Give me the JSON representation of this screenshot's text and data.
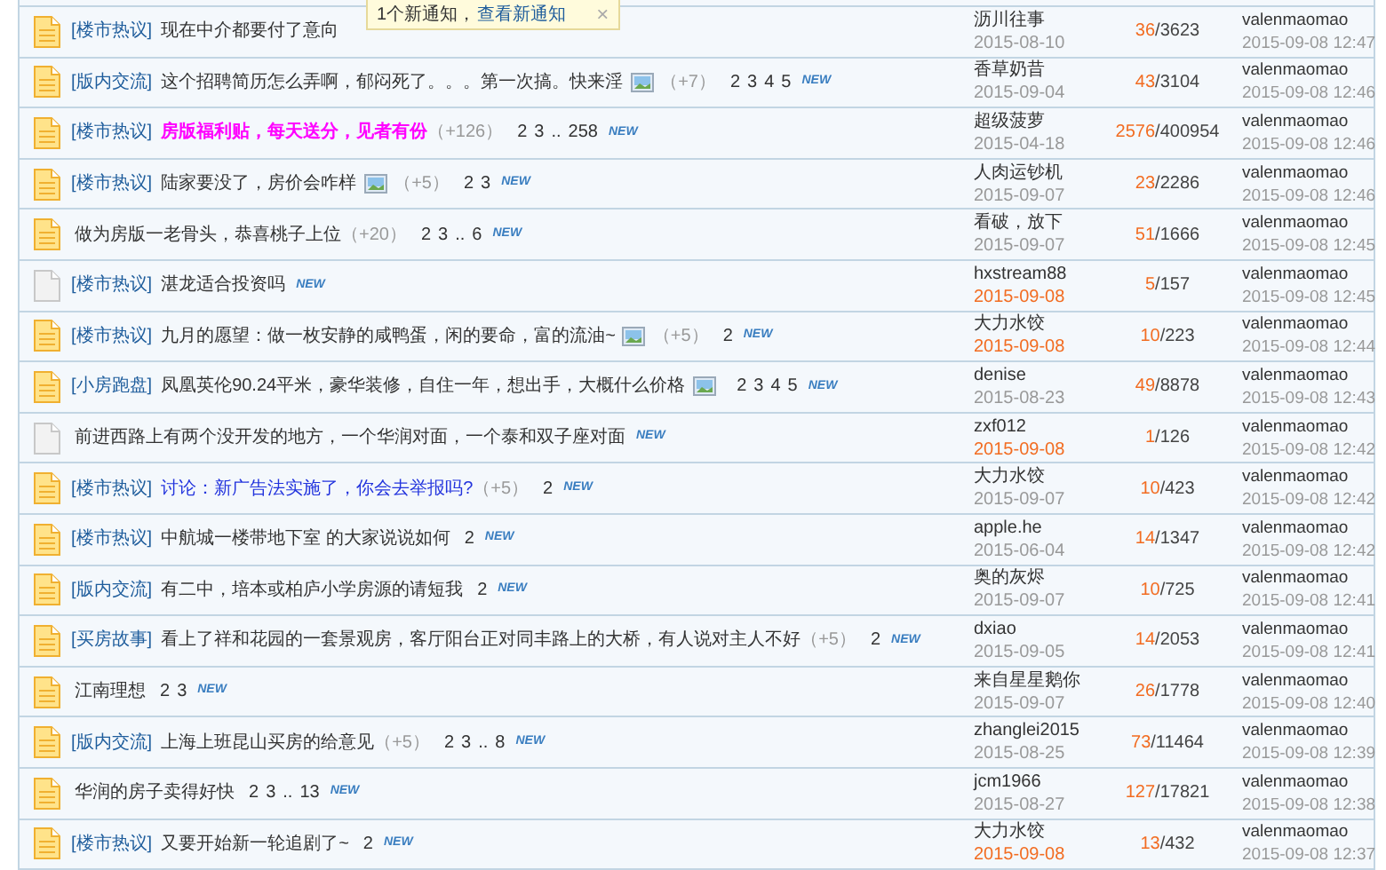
{
  "notification": {
    "text": "1个新通知，",
    "link": "查看新通知",
    "close": "×"
  },
  "threads": [
    {
      "kind": "hot",
      "category": "[楼市热议]",
      "title": "现在中介都要付了意向",
      "author": "沥川往事",
      "date": "2015-08-10",
      "date_recent": false,
      "counts": "36/3623",
      "last_poster": "valenmaomao",
      "last_time": "2015-09-08 12:47"
    },
    {
      "kind": "hot",
      "category": "[版内交流]",
      "title": "这个招聘简历怎么弄啊，郁闷死了。。。第一次搞。快来淫",
      "has_image": true,
      "bonus": "（+7）",
      "pages": [
        "2",
        "3",
        "4",
        "5"
      ],
      "badge": "NEW",
      "author": "香草奶昔",
      "date": "2015-09-04",
      "date_recent": false,
      "counts": "43/3104",
      "last_poster": "valenmaomao",
      "last_time": "2015-09-08 12:46"
    },
    {
      "kind": "hot",
      "category": "[楼市热议]",
      "title": "房版福利贴，每天送分，见者有份",
      "color": "#ff00ff",
      "title_bold": true,
      "bonus": "（+126）",
      "pages": [
        "2",
        "3",
        "..",
        "258"
      ],
      "badge": "NEW",
      "author": "超级菠萝",
      "date": "2015-04-18",
      "date_recent": false,
      "counts": "2576/400954",
      "last_poster": "valenmaomao",
      "last_time": "2015-09-08 12:46"
    },
    {
      "kind": "hot",
      "category": "[楼市热议]",
      "title": "陆家要没了，房价会咋样",
      "has_image": true,
      "bonus": "（+5）",
      "pages": [
        "2",
        "3"
      ],
      "badge": "NEW",
      "author": "人肉运钞机",
      "date": "2015-09-07",
      "date_recent": false,
      "counts": "23/2286",
      "last_poster": "valenmaomao",
      "last_time": "2015-09-08 12:46"
    },
    {
      "kind": "hot",
      "title": "做为房版一老骨头，恭喜桃子上位",
      "bonus": "（+20）",
      "pages": [
        "2",
        "3",
        "..",
        "6"
      ],
      "badge": "NEW",
      "author": "看破，放下",
      "date": "2015-09-07",
      "date_recent": false,
      "counts": "51/1666",
      "last_poster": "valenmaomao",
      "last_time": "2015-09-08 12:45"
    },
    {
      "kind": "normal",
      "category": "[楼市热议]",
      "title": "湛龙适合投资吗",
      "badge": "NEW",
      "author": "hxstream88",
      "date": "2015-09-08",
      "date_recent": true,
      "counts": "5/157",
      "last_poster": "valenmaomao",
      "last_time": "2015-09-08 12:45"
    },
    {
      "kind": "hot",
      "category": "[楼市热议]",
      "title": "九月的愿望：做一枚安静的咸鸭蛋，闲的要命，富的流油~",
      "has_image": true,
      "bonus": "（+5）",
      "pages": [
        "2"
      ],
      "badge": "NEW",
      "author": "大力水饺",
      "date": "2015-09-08",
      "date_recent": true,
      "counts": "10/223",
      "last_poster": "valenmaomao",
      "last_time": "2015-09-08 12:44"
    },
    {
      "kind": "hot",
      "category": "[小房跑盘]",
      "title": "凤凰英伦90.24平米，豪华装修，自住一年，想出手，大概什么价格",
      "has_image": true,
      "pages": [
        "2",
        "3",
        "4",
        "5"
      ],
      "badge": "NEW",
      "author": "denise",
      "date": "2015-08-23",
      "date_recent": false,
      "counts": "49/8878",
      "last_poster": "valenmaomao",
      "last_time": "2015-09-08 12:43"
    },
    {
      "kind": "normal",
      "title": "前进西路上有两个没开发的地方，一个华润对面，一个泰和双子座对面",
      "badge": "NEW",
      "author": "zxf012",
      "date": "2015-09-08",
      "date_recent": true,
      "counts": "1/126",
      "last_poster": "valenmaomao",
      "last_time": "2015-09-08 12:42"
    },
    {
      "kind": "hot",
      "category": "[楼市热议]",
      "title": "讨论：新广告法实施了，你会去举报吗?",
      "color": "#2233dd",
      "bonus": "（+5）",
      "pages": [
        "2"
      ],
      "badge": "NEW",
      "author": "大力水饺",
      "date": "2015-09-07",
      "date_recent": false,
      "counts": "10/423",
      "last_poster": "valenmaomao",
      "last_time": "2015-09-08 12:42"
    },
    {
      "kind": "hot",
      "category": "[楼市热议]",
      "title": "中航城一楼带地下室 的大家说说如何",
      "pages": [
        "2"
      ],
      "badge": "NEW",
      "author": "apple.he",
      "date": "2015-06-04",
      "date_recent": false,
      "counts": "14/1347",
      "last_poster": "valenmaomao",
      "last_time": "2015-09-08 12:42"
    },
    {
      "kind": "hot",
      "category": "[版内交流]",
      "title": "有二中，培本或柏庐小学房源的请短我",
      "pages": [
        "2"
      ],
      "badge": "NEW",
      "author": "奥的灰烬",
      "date": "2015-09-07",
      "date_recent": false,
      "counts": "10/725",
      "last_poster": "valenmaomao",
      "last_time": "2015-09-08 12:41"
    },
    {
      "kind": "hot",
      "category": "[买房故事]",
      "title": "看上了祥和花园的一套景观房，客厅阳台正对同丰路上的大桥，有人说对主人不好",
      "bonus": "（+5）",
      "pages": [
        "2"
      ],
      "badge": "NEW",
      "author": "dxiao",
      "date": "2015-09-05",
      "date_recent": false,
      "counts": "14/2053",
      "last_poster": "valenmaomao",
      "last_time": "2015-09-08 12:41"
    },
    {
      "kind": "hot",
      "title": "江南理想",
      "pages": [
        "2",
        "3"
      ],
      "badge": "NEW",
      "author": "来自星星鹅你",
      "date": "2015-09-07",
      "date_recent": false,
      "counts": "26/1778",
      "last_poster": "valenmaomao",
      "last_time": "2015-09-08 12:40"
    },
    {
      "kind": "hot",
      "category": "[版内交流]",
      "title": "上海上班昆山买房的给意见",
      "bonus": "（+5）",
      "pages": [
        "2",
        "3",
        "..",
        "8"
      ],
      "badge": "NEW",
      "author": "zhanglei2015",
      "date": "2015-08-25",
      "date_recent": false,
      "counts": "73/11464",
      "last_poster": "valenmaomao",
      "last_time": "2015-09-08 12:39"
    },
    {
      "kind": "hot",
      "title": "华润的房子卖得好快",
      "pages": [
        "2",
        "3",
        "..",
        "13"
      ],
      "badge": "NEW",
      "author": "jcm1966",
      "date": "2015-08-27",
      "date_recent": false,
      "counts": "127/17821",
      "last_poster": "valenmaomao",
      "last_time": "2015-09-08 12:38"
    },
    {
      "kind": "hot",
      "category": "[楼市热议]",
      "title": "又要开始新一轮追剧了~",
      "pages": [
        "2"
      ],
      "badge": "NEW",
      "author": "大力水饺",
      "date": "2015-09-08",
      "date_recent": true,
      "counts": "13/432",
      "last_poster": "valenmaomao",
      "last_time": "2015-09-08 12:37"
    }
  ]
}
